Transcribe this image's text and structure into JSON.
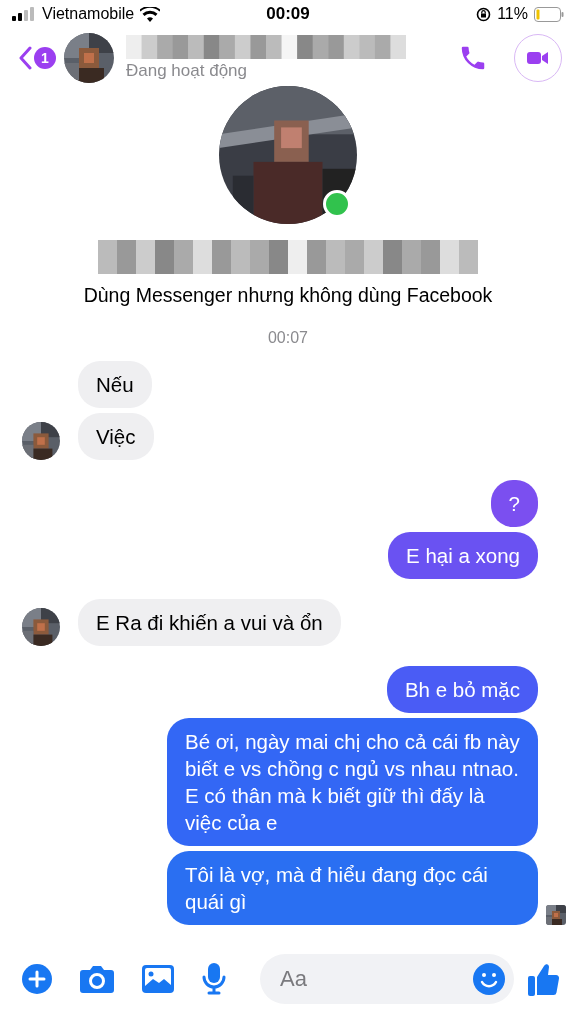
{
  "status_bar": {
    "carrier": "Vietnamobile",
    "time": "00:09",
    "battery": "11%"
  },
  "header": {
    "back_badge": "1",
    "status": "Đang hoạt động"
  },
  "profile": {
    "online": true,
    "subtitle": "Dùng Messenger nhưng không dùng Facebook"
  },
  "timestamp": "00:07",
  "groups": [
    {
      "kind": "incoming",
      "messages": [
        {
          "text": "Nếu"
        },
        {
          "text": "Việc"
        }
      ]
    },
    {
      "kind": "outgoing",
      "messages": [
        {
          "text": "?",
          "color": "#7b4ff0"
        },
        {
          "text": "E hại a xong",
          "color": "#6a52f2"
        }
      ]
    },
    {
      "kind": "incoming",
      "messages": [
        {
          "text": "E Ra đi khiến a vui và ổn"
        }
      ]
    },
    {
      "kind": "outgoing",
      "messages": [
        {
          "text": "Bh e bỏ mặc",
          "color": "#4a5cf5"
        },
        {
          "text": "Bé ơi, ngày mai chị cho cả cái fb này biết e vs chồng c ngủ vs nhau ntnao. E có thân mà k biết giữ thì đấy là việc của e",
          "color": "#3367f5"
        },
        {
          "text": "Tôi là vợ, mà đ hiểu đang đọc cái quái gì",
          "color": "#2a6ff2"
        }
      ]
    }
  ],
  "composer": {
    "placeholder": "Aa"
  }
}
